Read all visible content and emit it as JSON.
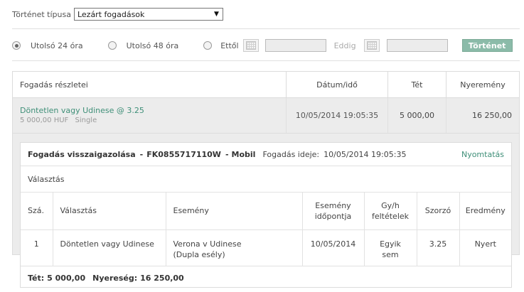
{
  "history_type": {
    "label": "Történet típusa",
    "selected": "Lezárt fogadások"
  },
  "filters": {
    "last24_label": "Utolsó 24 óra",
    "last48_label": "Utolsó 48 óra",
    "from_label": "Ettől",
    "to_label": "Eddig",
    "from_value": "",
    "to_value": "",
    "history_button": "Történet"
  },
  "table": {
    "headers": {
      "details": "Fogadás részletei",
      "datetime": "Dátum/idő",
      "stake": "Tét",
      "winnings": "Nyeremény"
    },
    "bet": {
      "name": "Döntetlen vagy Udinese @ 3.25",
      "amount": "5 000,00 HUF",
      "type": "Single",
      "datetime": "10/05/2014 19:05:35",
      "stake": "5 000,00",
      "winnings": "16 250,00"
    }
  },
  "confirmation": {
    "title": "Fogadás visszaigazolása",
    "dash": "-",
    "id": "FK0855717110W",
    "channel": "Mobil",
    "bet_time_label": "Fogadás ideje:",
    "bet_time_value": "10/05/2014 19:05:35",
    "print_label": "Nyomtatás",
    "selection_heading": "Választás",
    "columns": {
      "no": "Szá.",
      "selection": "Választás",
      "event": "Esemény",
      "event_time_line1": "Esemény",
      "event_time_line2": "időpontja",
      "terms_line1": "Gy/h",
      "terms_line2": "feltételek",
      "odds": "Szorzó",
      "result": "Eredmény"
    },
    "row": {
      "no": "1",
      "selection": "Döntetlen vagy Udinese",
      "event_line1": "Verona v Udinese",
      "event_line2": "(Dupla esély)",
      "event_date": "10/05/2014",
      "terms_line1": "Egyik",
      "terms_line2": "sem",
      "odds": "3.25",
      "result": "Nyert"
    },
    "totals": {
      "stake_label": "Tét:",
      "stake_value": "5 000,00",
      "winnings_label": "Nyereség:",
      "winnings_value": "16 250,00"
    }
  },
  "colors": {
    "accent_green": "#3f8f78",
    "button_green": "#8bbba9",
    "row_gray": "#ececec"
  }
}
